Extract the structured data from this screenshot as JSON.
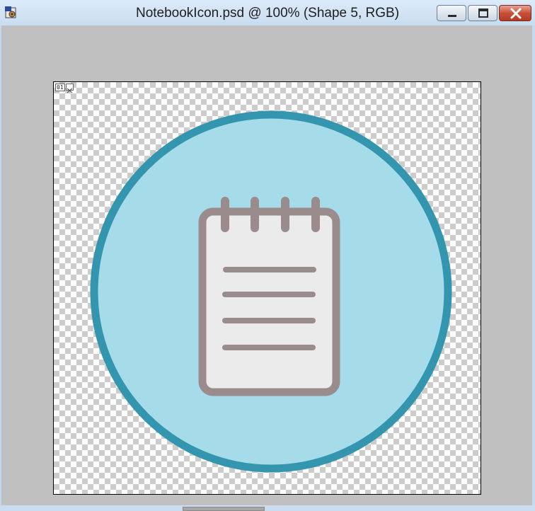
{
  "window": {
    "title": "NotebookIcon.psd @ 100% (Shape 5, RGB)",
    "controls": {
      "minimize_icon": "minimize-icon",
      "maximize_icon": "maximize-icon",
      "close_icon": "close-icon"
    }
  },
  "canvas": {
    "layer_number": "01",
    "colors": {
      "circle_fill": "#a6dbea",
      "circle_ring": "#3395ae",
      "notebook_page": "#ebebeb",
      "notebook_outline": "#9a8c8c"
    },
    "icon": "notebook-icon"
  }
}
